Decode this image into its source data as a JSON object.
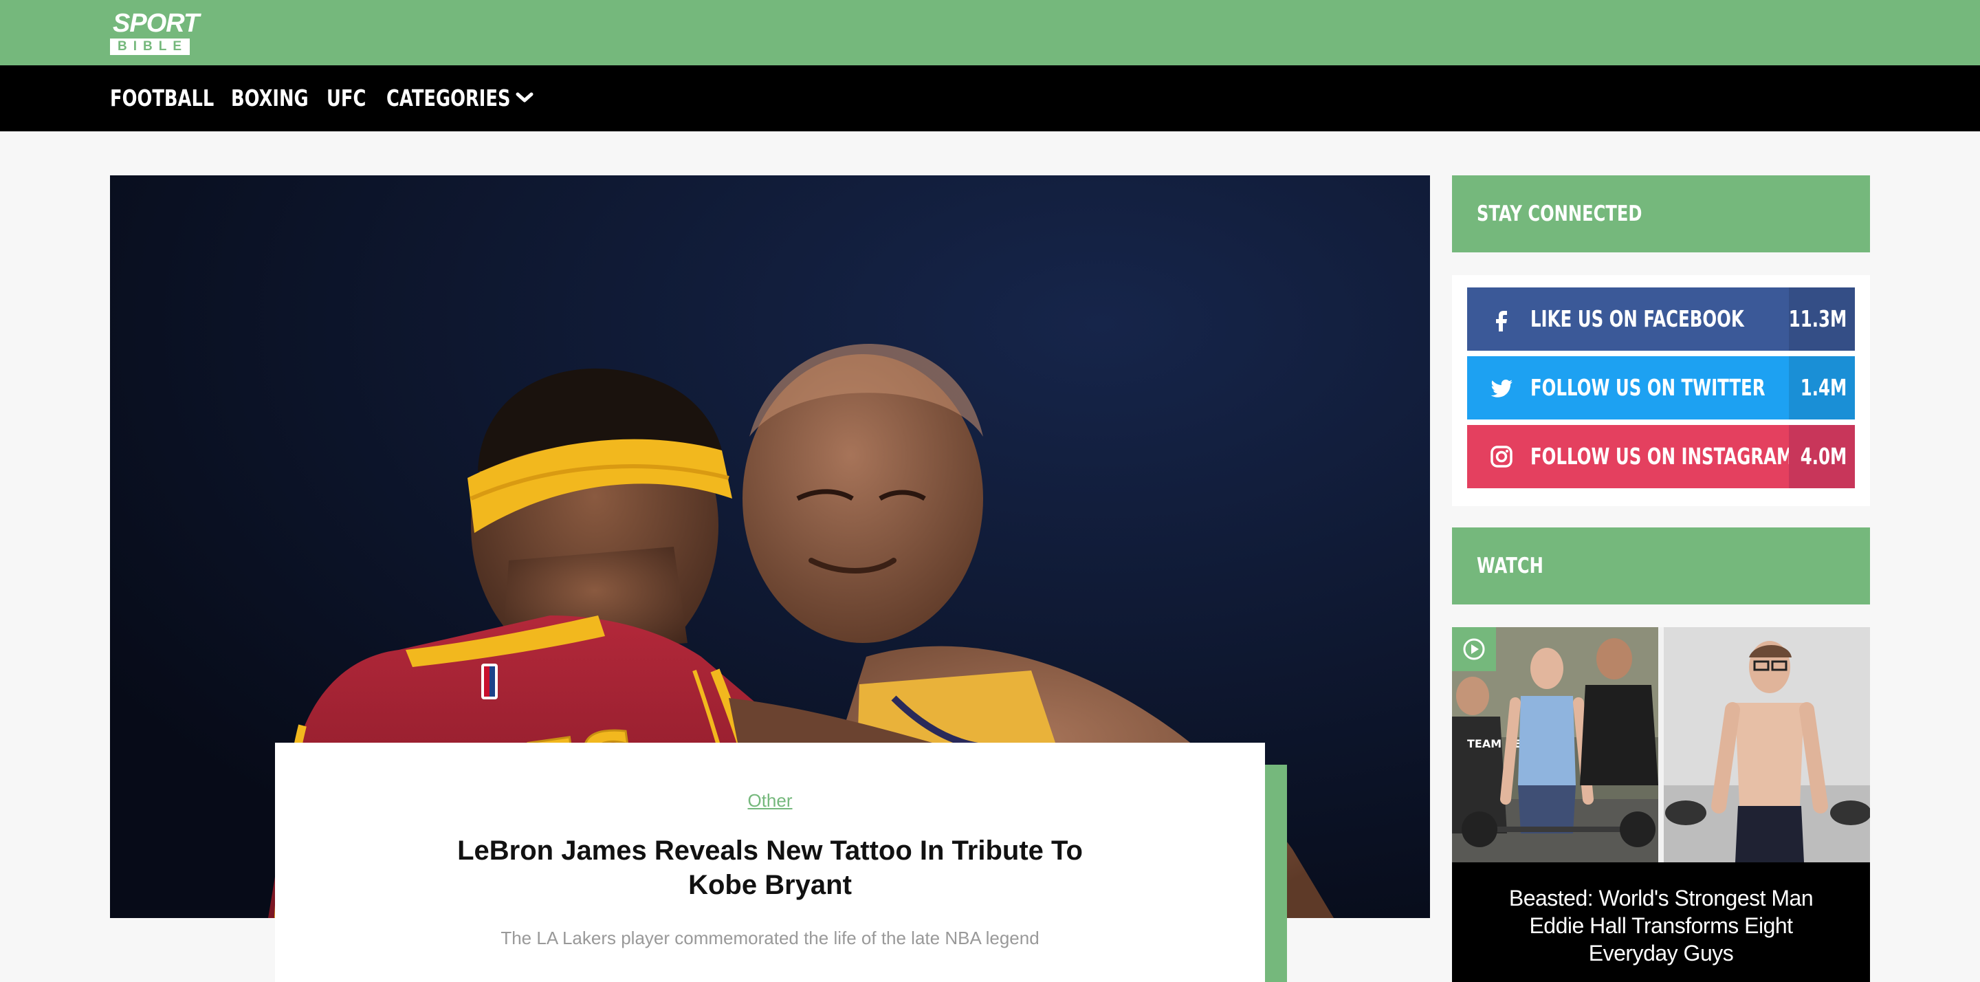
{
  "brand": {
    "logo_top": "SPORT",
    "logo_bottom": "BIBLE",
    "color": "#75b87c"
  },
  "nav": {
    "items": [
      {
        "label": "FOOTBALL"
      },
      {
        "label": "BOXING"
      },
      {
        "label": "UFC"
      },
      {
        "label": "CATEGORIES"
      }
    ],
    "dropdown_icon": "chevron-down-icon"
  },
  "featured": {
    "image_alt": "LeBron James and Kobe Bryant embracing on court",
    "jersey_text": "JAMES",
    "category": "Other",
    "title": "LeBron James Reveals New Tattoo In Tribute To Kobe Bryant",
    "subtitle": "The LA Lakers player commemorated the life of the late NBA legend"
  },
  "sidebar": {
    "stay_connected": {
      "heading": "STAY CONNECTED",
      "socials": [
        {
          "icon": "facebook-icon",
          "label": "LIKE US ON FACEBOOK",
          "count": "11.3M",
          "color": "#3b5998",
          "count_color": "#344e86"
        },
        {
          "icon": "twitter-icon",
          "label": "FOLLOW US ON TWITTER",
          "count": "1.4M",
          "color": "#1da1f2",
          "count_color": "#1a8fd6"
        },
        {
          "icon": "instagram-icon",
          "label": "FOLLOW US ON INSTAGRAM",
          "count": "4.0M",
          "color": "#e4405f",
          "count_color": "#c8365a"
        }
      ]
    },
    "watch": {
      "heading": "WATCH",
      "video_title": "Beasted: World's Strongest Man Eddie Hall Transforms Eight Everyday Guys",
      "shirt_text": "TEAM BEAST",
      "play_icon": "play-icon"
    }
  }
}
